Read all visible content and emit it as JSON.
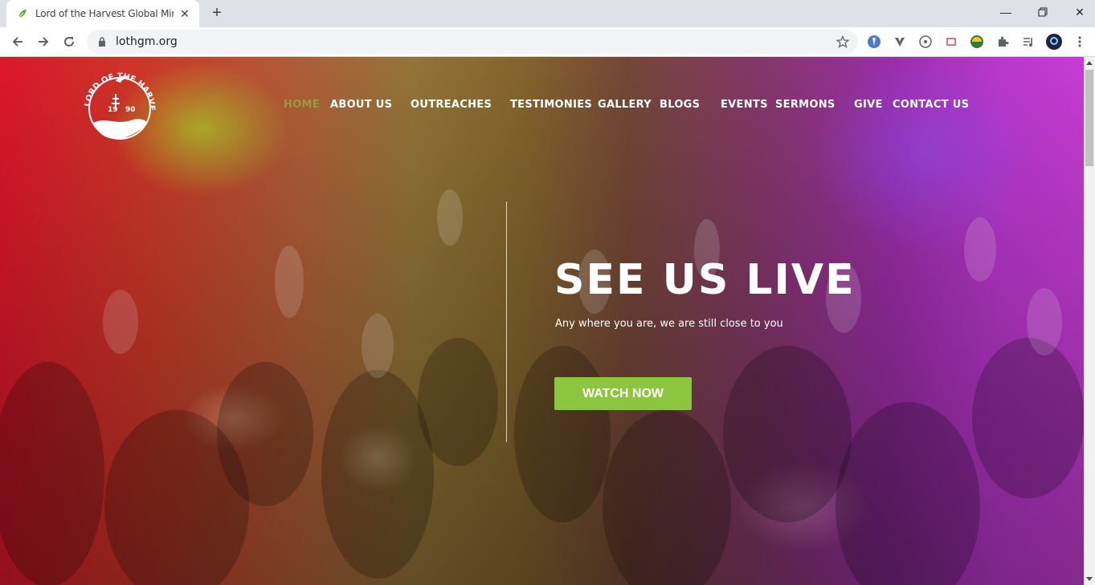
{
  "browser": {
    "tab_title": "Lord of the Harvest Global Minist",
    "url": "lothgm.org",
    "icons": [
      "back-arrow-icon",
      "forward-arrow-icon",
      "reload-icon",
      "lock-icon",
      "star-icon",
      "extensions-icon",
      "profile-avatar-icon"
    ]
  },
  "site": {
    "logo": {
      "arc_text": "LORD OF THE HARVEST",
      "year_left": "19",
      "year_right": "90"
    },
    "nav": [
      {
        "label": "HOME",
        "active": true
      },
      {
        "label": "ABOUT US"
      },
      {
        "label": "OUTREACHES"
      },
      {
        "label": "TESTIMONIES"
      },
      {
        "label": "GALLERY"
      },
      {
        "label": "BLOGS"
      },
      {
        "label": "EVENTS"
      },
      {
        "label": "SERMONS"
      },
      {
        "label": "GIVE"
      },
      {
        "label": "CONTACT US"
      }
    ],
    "hero": {
      "title": "SEE US LIVE",
      "subtitle": "Any where you are, we are still close to you",
      "cta_label": "WATCH NOW"
    }
  },
  "colors": {
    "accent_green": "#8cc63f",
    "chrome_bg": "#dee1e6"
  }
}
